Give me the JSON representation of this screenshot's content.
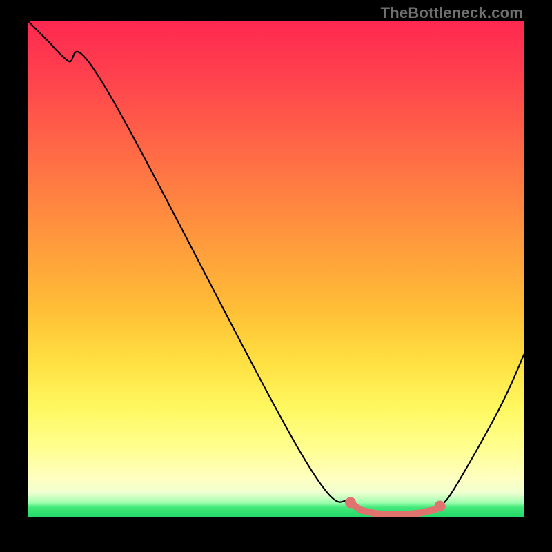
{
  "watermark": "TheBottleneck.com",
  "chart_data": {
    "type": "line",
    "title": "",
    "xlabel": "",
    "ylabel": "",
    "xlim": [
      0,
      100
    ],
    "ylim": [
      0,
      100
    ],
    "series": [
      {
        "name": "curve",
        "x": [
          0,
          4,
          8,
          16,
          55,
          65,
          67,
          70,
          73,
          76,
          79,
          82,
          83,
          86,
          95,
          100
        ],
        "values": [
          100,
          96,
          92,
          86,
          13,
          3,
          1.5,
          0.8,
          0.6,
          0.6,
          0.9,
          1.6,
          2.3,
          6,
          22,
          33
        ]
      }
    ],
    "marker_region": {
      "color": "#e0736f",
      "x": [
        65,
        67,
        70,
        73,
        76,
        79,
        82,
        83
      ],
      "values": [
        3,
        1.5,
        0.8,
        0.6,
        0.6,
        0.9,
        1.6,
        2.3
      ]
    }
  }
}
